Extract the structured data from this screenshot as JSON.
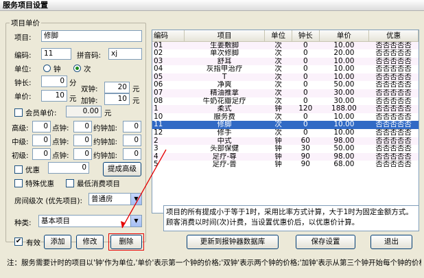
{
  "window": {
    "title": "服务项目设置"
  },
  "group_title": "项目单价",
  "form": {
    "item_label": "项目:",
    "item_value": "修脚",
    "code_label": "编码:",
    "code_value": "11",
    "pinyin_label": "拼音码:",
    "pinyin_value": "xj",
    "unit_label": "单位:",
    "unit_option_clock": "钟",
    "unit_option_time": "次",
    "unit_selected": "次",
    "duration_label": "钟长:",
    "duration_value": "0",
    "duration_unit": "分",
    "price_label": "单价:",
    "price_value": "10",
    "price_unit": "元",
    "double_label": "双钟:",
    "double_value": "20",
    "double_unit": "元",
    "extra_label": "加钟:",
    "extra_value": "10",
    "extra_unit": "元",
    "member_label": "会员单价:",
    "member_value": "0.00",
    "member_unit": "元",
    "senior_label": "高级:",
    "mid_label": "中级:",
    "junior_label": "初级:",
    "point_label": "点钟:",
    "appoint_label": "约钟加:",
    "grade_value": "0",
    "discount_label": "优惠",
    "discount_value": "0",
    "commission_button": "提成高级",
    "special_discount_label": "特殊优惠",
    "min_consume_label": "最低消费项目",
    "room_level_label": "房间级次 (优先项目):",
    "room_level_value": "普通房",
    "category_label": "种类:",
    "category_value": "基本项目",
    "valid_label": "有效"
  },
  "buttons": {
    "add": "添加",
    "modify": "修改",
    "delete": "删除",
    "update_db": "更新到报钟器数据库",
    "save": "保存设置",
    "exit": "退出"
  },
  "table": {
    "headers": [
      "编码",
      "项目",
      "单位",
      "钟长",
      "单价",
      "优惠"
    ],
    "rows": [
      [
        "01",
        "生姜敷脚",
        "次",
        "0",
        "10.00",
        "否否否否否"
      ],
      [
        "02",
        "单次修脚",
        "次",
        "0",
        "20.00",
        "否否否否否"
      ],
      [
        "03",
        "舒耳",
        "次",
        "0",
        "10.00",
        "否否否否否"
      ],
      [
        "04",
        "灰指甲治疗",
        "次",
        "0",
        "10.00",
        "否否否否否"
      ],
      [
        "05",
        "T",
        "次",
        "0",
        "10.00",
        "否否否否否"
      ],
      [
        "06",
        "净爽",
        "次",
        "0",
        "50.00",
        "否否否否否"
      ],
      [
        "07",
        "精油推拿",
        "次",
        "0",
        "30.00",
        "否否否否否"
      ],
      [
        "08",
        "牛奶花瓣足疗",
        "次",
        "0",
        "30.00",
        "否否否否否"
      ],
      [
        "1",
        "柔式",
        "钟",
        "120",
        "188.00",
        "否否否否否"
      ],
      [
        "10",
        "服务费",
        "次",
        "0",
        "10.00",
        "否否否否否"
      ],
      [
        "11",
        "修脚",
        "次",
        "0",
        "10.00",
        "否否否否否"
      ],
      [
        "12",
        "修手",
        "次",
        "0",
        "10.00",
        "否否否否否"
      ],
      [
        "2",
        "中式",
        "钟",
        "60",
        "98.00",
        "否否否否否"
      ],
      [
        "3",
        "头部保健",
        "钟",
        "30",
        "50.00",
        "否否否否否"
      ],
      [
        "4",
        "足疗-尊",
        "钟",
        "90",
        "98.00",
        "否否否否否"
      ],
      [
        "5",
        "足疗-普",
        "钟",
        "90",
        "68.00",
        "否否否否否"
      ]
    ],
    "selected_index": 10
  },
  "info_note": "项目的所有提成小于等于1时，采用比率方式计算，大于1时为固定金额方式。\n顾客消费以时间(次)计费，当设置优惠价后，以优惠价计算。",
  "bottom_note": "注：服务需要计时的项目以'钟'作为单位,'单价'表示第一个钟的价格;'双钟'表示两个钟的价格;'加钟'表示从第三个钟开始每个钟的价格. 如果以'次'作为单位时,'单价'表示单次价格,'双钟'表示两次价格,'加钟'表示第三次以上每次的价格."
}
